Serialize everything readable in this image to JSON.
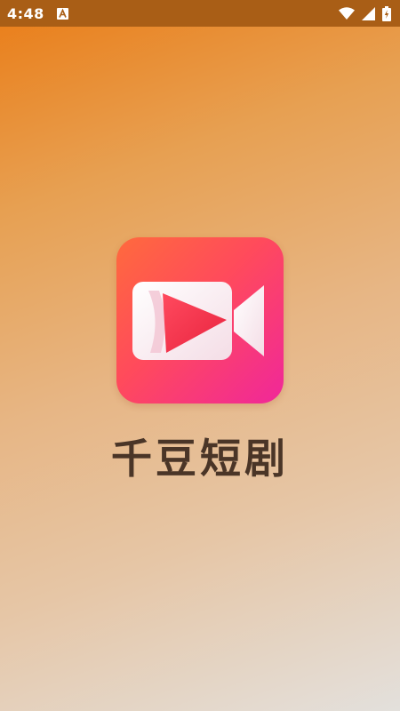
{
  "status_bar": {
    "time": "4:48",
    "icons": [
      "notification-a-icon",
      "wifi-icon",
      "cell-signal-icon",
      "battery-charging-icon"
    ]
  },
  "splash": {
    "app_name": "千豆短剧",
    "logo_icon": "video-play-camera-icon"
  },
  "colors": {
    "status_bar": "#a95e16",
    "logo_gradient_start": "#ff6a3d",
    "logo_gradient_end": "#f0279a",
    "app_name_text": "#4a3527"
  }
}
